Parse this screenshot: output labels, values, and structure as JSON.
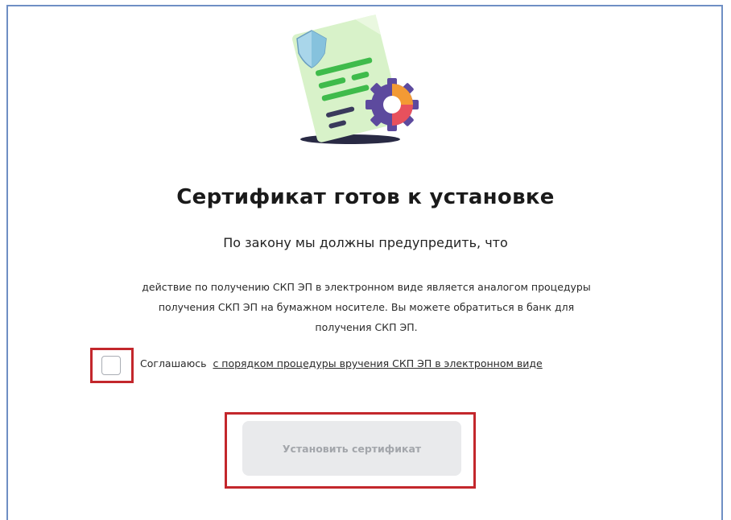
{
  "dialog": {
    "title": "Сертификат готов к установке",
    "subtitle": "По закону мы должны предупредить, что",
    "description_lines": [
      "действие по получению СКП ЭП в электронном виде является аналогом процедуры",
      "получения СКП ЭП на бумажном носителе. Вы можете обратиться в банк для",
      "получения СКП ЭП."
    ],
    "agreement": {
      "prefix": "Соглашаюсь",
      "link_text": "с порядком процедуры вручения СКП ЭП в электронном виде",
      "checked": false
    },
    "install_button": {
      "label": "Установить сертификат",
      "disabled": true
    }
  },
  "colors": {
    "highlight": "#c3272c",
    "button_bg": "#e9eaec",
    "button_text": "#a3a6ab",
    "frame_border": "#6f8fc4"
  },
  "icons": {
    "illustration": "certificate-document-with-shield-and-gear"
  }
}
